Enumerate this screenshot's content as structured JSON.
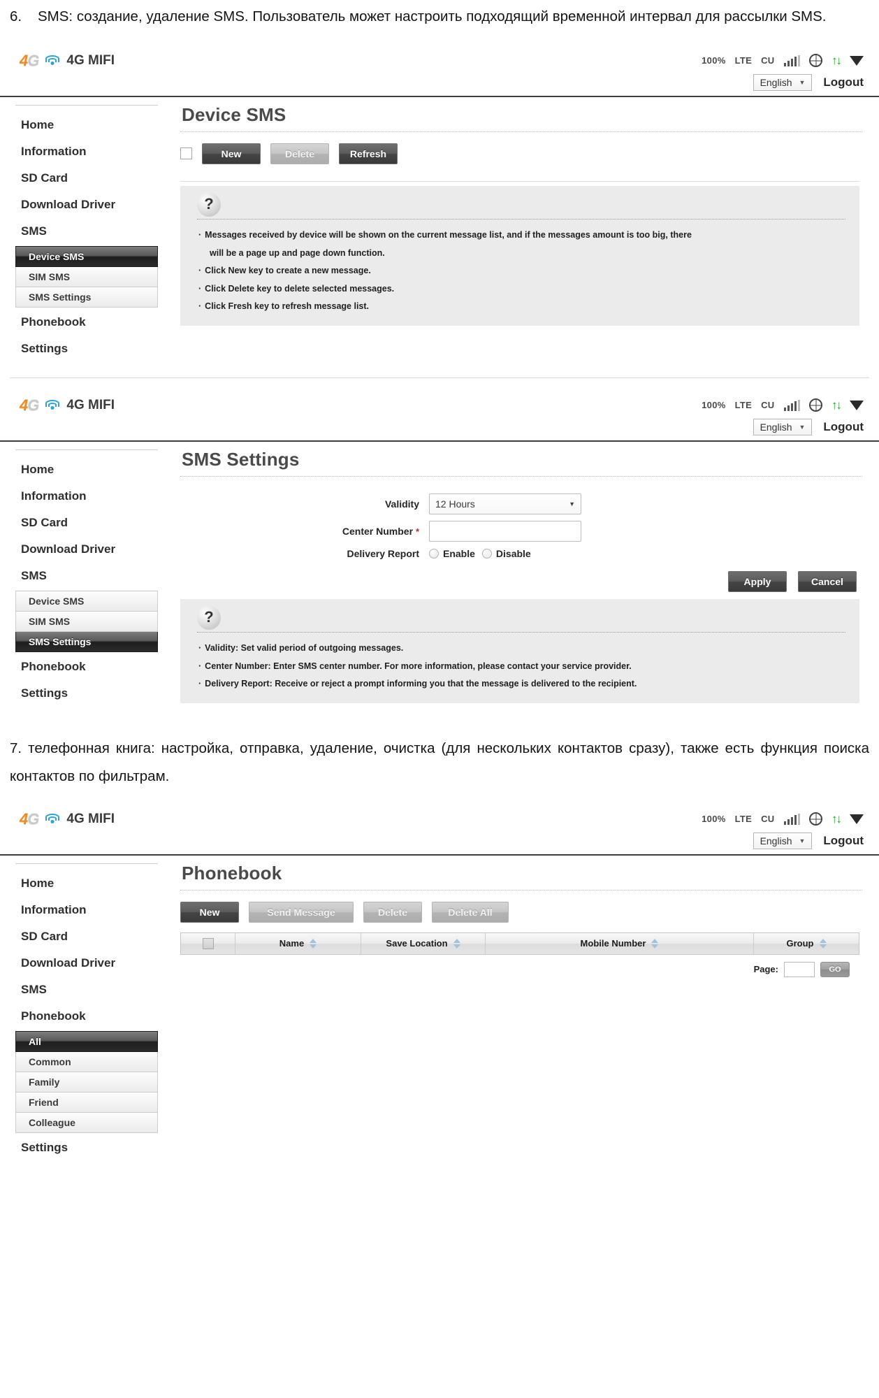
{
  "doc": {
    "item6": {
      "num": "6.",
      "text": "SMS: создание, удаление SMS. Пользователь может настроить подходящий временной интервал для рассылки SMS."
    },
    "item7": {
      "text": "7. телефонная книга: настройка, отправка, удаление, очистка (для нескольких контактов сразу), также есть функция поиска контактов по фильтрам."
    }
  },
  "header": {
    "logo_4": "4",
    "logo_g": "G",
    "brand_name": "4G MIFI",
    "battery": "100%",
    "network": "LTE",
    "carrier": "CU",
    "language": "English",
    "logout": "Logout",
    "icons": {
      "wifi": "wifi-icon",
      "signal": "signal-bars-icon",
      "globe": "globe-icon",
      "traffic": "up-down-arrows-icon",
      "caret": "down-triangle-icon"
    }
  },
  "sidebar": {
    "main_items": [
      "Home",
      "Information",
      "SD Card",
      "Download Driver",
      "SMS",
      "Phonebook",
      "Settings"
    ],
    "sms_sub": [
      "Device SMS",
      "SIM SMS",
      "SMS Settings"
    ],
    "phonebook_groups": [
      "All",
      "Common",
      "Family",
      "Friend",
      "Colleague"
    ]
  },
  "panel_device_sms": {
    "title": "Device SMS",
    "buttons": {
      "new": "New",
      "delete": "Delete",
      "refresh": "Refresh"
    },
    "help": {
      "icon": "?",
      "bullets": [
        "Messages received by device will be shown on the current message list, and if the messages amount is too big, there",
        "Click New key to create a new message.",
        "Click Delete key to delete selected messages.",
        "Click Fresh key to refresh message list."
      ],
      "continuation": "will be a page up and page down function."
    }
  },
  "panel_sms_settings": {
    "title": "SMS Settings",
    "fields": {
      "validity_label": "Validity",
      "validity_value": "12 Hours",
      "center_label": "Center Number",
      "center_required": "*",
      "center_value": "",
      "delivery_label": "Delivery Report",
      "delivery_enable": "Enable",
      "delivery_disable": "Disable"
    },
    "buttons": {
      "apply": "Apply",
      "cancel": "Cancel"
    },
    "help": {
      "icon": "?",
      "bullets": [
        "Validity: Set valid period of outgoing messages.",
        "Center Number: Enter SMS center number. For more information, please contact your service provider.",
        "Delivery Report: Receive or reject a prompt informing you that the message is delivered to the recipient."
      ]
    }
  },
  "panel_phonebook": {
    "title": "Phonebook",
    "buttons": {
      "new": "New",
      "send_message": "Send Message",
      "delete": "Delete",
      "delete_all": "Delete All"
    },
    "table": {
      "columns": [
        "Name",
        "Save Location",
        "Mobile Number",
        "Group"
      ],
      "rows": []
    },
    "pager": {
      "label": "Page:",
      "value": "",
      "go": "GO"
    }
  }
}
